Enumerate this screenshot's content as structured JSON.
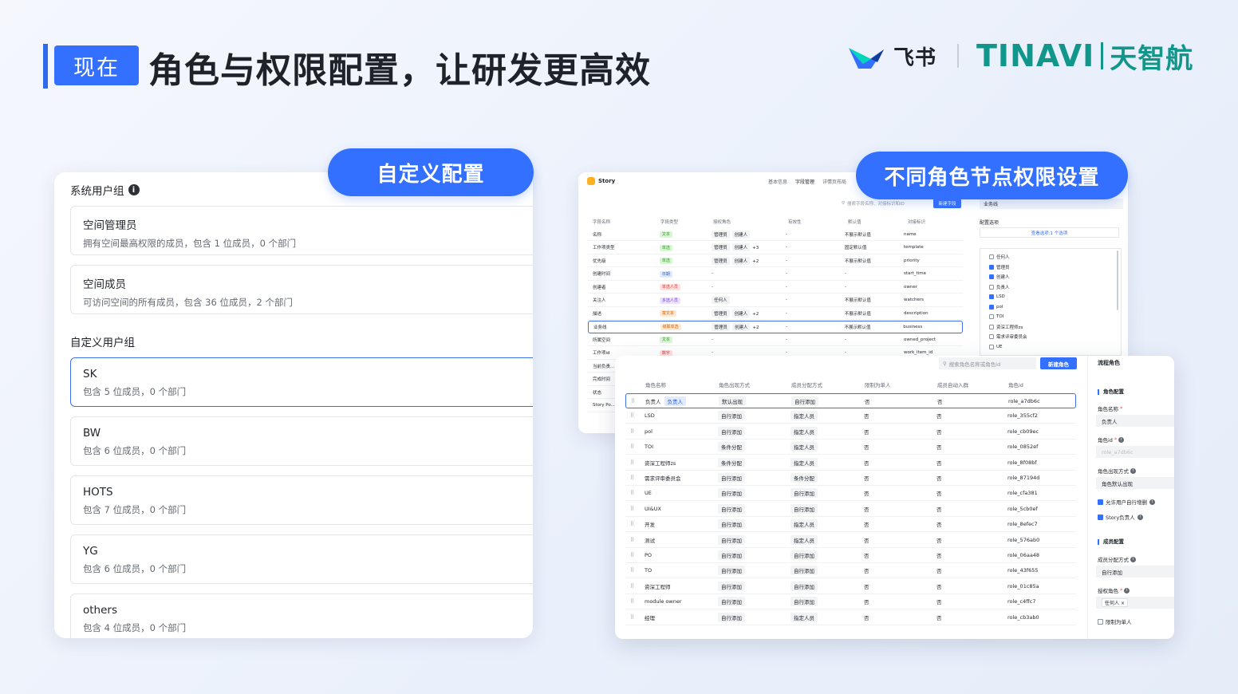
{
  "header": {
    "badge": "现在",
    "title": "角色与权限配置，让研发更高效",
    "brand_feishu": "飞书",
    "brand_tinavi": "TINAVI",
    "brand_tinavi_cn": "天智航",
    "accent_color": "#3370ff",
    "brand_color": "#11968b"
  },
  "pills": {
    "left": "自定义配置",
    "right": "不同角色节点权限设置"
  },
  "left_panel": {
    "system_title": "系统用户组",
    "system_groups": [
      {
        "name": "空间管理员",
        "desc": "拥有空间最高权限的成员，包含 1 位成员，0 个部门"
      },
      {
        "name": "空间成员",
        "desc": "可访问空间的所有成员，包含 36 位成员，2 个部门"
      }
    ],
    "custom_title": "自定义用户组",
    "custom_groups": [
      {
        "name": "SK",
        "desc": "包含 5 位成员，0 个部门"
      },
      {
        "name": "BW",
        "desc": "包含 6 位成员，0 个部门"
      },
      {
        "name": "HOTS",
        "desc": "包含 7 位成员，0 个部门"
      },
      {
        "name": "YG",
        "desc": "包含 6 位成员，0 个部门"
      },
      {
        "name": "others",
        "desc": "包含 4 位成员，0 个部门"
      }
    ]
  },
  "fields_panel": {
    "title": "Story",
    "tabs": [
      "基本信息",
      "字段管理",
      "详情页布局"
    ],
    "search_placeholder": "搜索字段名称、对接标识和ID",
    "new_button": "新建字段",
    "biz_value": "业务线",
    "options_title": "配置选项",
    "options_link": "查看选项:1 个选项",
    "columns": [
      "字段名称",
      "字段类型",
      "授权角色",
      "有效性",
      "默认值",
      "对接标识"
    ],
    "options": [
      {
        "label": "任何人",
        "checked": false
      },
      {
        "label": "管理员",
        "checked": true
      },
      {
        "label": "创建人",
        "checked": true
      },
      {
        "label": "负责人",
        "checked": false
      },
      {
        "label": "LSD",
        "checked": true
      },
      {
        "label": "pol",
        "checked": true
      },
      {
        "label": "TOI",
        "checked": false
      },
      {
        "label": "资深工程师zs",
        "checked": false
      },
      {
        "label": "需求评审委员会",
        "checked": false
      },
      {
        "label": "UE",
        "checked": false
      }
    ],
    "rows": [
      {
        "name": "名称",
        "type": "文本",
        "tag": "green",
        "roles": [
          "管理员",
          "创建人"
        ],
        "extra": "",
        "valid": "-",
        "default": "不展示默认值",
        "key": "name"
      },
      {
        "name": "工作项类型",
        "type": "单选",
        "tag": "green",
        "roles": [
          "管理员",
          "创建人"
        ],
        "extra": "+3",
        "valid": "-",
        "default": "固定默认值",
        "key": "template"
      },
      {
        "name": "优先级",
        "type": "单选",
        "tag": "green",
        "roles": [
          "管理员",
          "创建人"
        ],
        "extra": "+2",
        "valid": "-",
        "default": "不展示默认值",
        "key": "priority"
      },
      {
        "name": "创建时间",
        "type": "日期",
        "tag": "blue",
        "roles": [],
        "extra": "",
        "valid": "-",
        "default": "-",
        "key": "start_time"
      },
      {
        "name": "创建者",
        "type": "单选人员",
        "tag": "red",
        "roles": [],
        "extra": "",
        "valid": "-",
        "default": "-",
        "key": "owner"
      },
      {
        "name": "关注人",
        "type": "多选人员",
        "tag": "purple",
        "roles": [
          "任何人"
        ],
        "extra": "",
        "valid": "-",
        "default": "不展示默认值",
        "key": "watchers"
      },
      {
        "name": "描述",
        "type": "富文本",
        "tag": "orange",
        "roles": [
          "管理员",
          "创建人"
        ],
        "extra": "+2",
        "valid": "-",
        "default": "不展示默认值",
        "key": "description"
      },
      {
        "name": "业务线",
        "type": "级联单选",
        "tag": "orange",
        "roles": [
          "管理员",
          "创建人"
        ],
        "extra": "+2",
        "valid": "-",
        "default": "不展示默认值",
        "key": "business"
      },
      {
        "name": "所属空间",
        "type": "文本",
        "tag": "green",
        "roles": [],
        "extra": "",
        "valid": "-",
        "default": "-",
        "key": "owned_project"
      },
      {
        "name": "工作项id",
        "type": "数字",
        "tag": "red",
        "roles": [],
        "extra": "",
        "valid": "-",
        "default": "-",
        "key": "work_item_id"
      },
      {
        "name": "当前负责...",
        "type": "",
        "tag": "",
        "roles": [],
        "extra": "",
        "valid": "",
        "default": "",
        "key": ""
      },
      {
        "name": "完成时间",
        "type": "",
        "tag": "",
        "roles": [],
        "extra": "",
        "valid": "",
        "default": "",
        "key": ""
      },
      {
        "name": "状态",
        "type": "",
        "tag": "",
        "roles": [],
        "extra": "",
        "valid": "",
        "default": "",
        "key": ""
      },
      {
        "name": "Story Po...",
        "type": "",
        "tag": "",
        "roles": [],
        "extra": "",
        "valid": "",
        "default": "",
        "key": ""
      }
    ]
  },
  "roles_panel": {
    "search_placeholder": "搜索角色名称或角色id",
    "new_button": "新建角色",
    "columns": [
      "角色名称",
      "角色出现方式",
      "成员分配方式",
      "限制为单人",
      "成员自动入群",
      "角色id"
    ],
    "rows": [
      {
        "name": "负责人",
        "owner_tag": "负责人",
        "appear": "默认出现",
        "assign": "自行添加",
        "single": "否",
        "auto": "否",
        "id": "role_a7db6c"
      },
      {
        "name": "LSD",
        "owner_tag": "",
        "appear": "自行添加",
        "assign": "指定人员",
        "single": "否",
        "auto": "否",
        "id": "role_355cf2"
      },
      {
        "name": "pol",
        "owner_tag": "",
        "appear": "自行添加",
        "assign": "指定人员",
        "single": "否",
        "auto": "否",
        "id": "role_cb09ec"
      },
      {
        "name": "TOI",
        "owner_tag": "",
        "appear": "条件分配",
        "assign": "指定人员",
        "single": "否",
        "auto": "否",
        "id": "role_0852ef"
      },
      {
        "name": "资深工程师zs",
        "owner_tag": "",
        "appear": "条件分配",
        "assign": "指定人员",
        "single": "否",
        "auto": "否",
        "id": "role_8f08bf"
      },
      {
        "name": "需求评审委员会",
        "owner_tag": "",
        "appear": "自行添加",
        "assign": "条件分配",
        "single": "否",
        "auto": "否",
        "id": "role_87194d"
      },
      {
        "name": "UE",
        "owner_tag": "",
        "appear": "自行添加",
        "assign": "自行添加",
        "single": "否",
        "auto": "否",
        "id": "role_cfa381"
      },
      {
        "name": "UI&UX",
        "owner_tag": "",
        "appear": "自行添加",
        "assign": "自行添加",
        "single": "否",
        "auto": "否",
        "id": "role_5cb0ef"
      },
      {
        "name": "开发",
        "owner_tag": "",
        "appear": "自行添加",
        "assign": "指定人员",
        "single": "否",
        "auto": "否",
        "id": "role_8efec7"
      },
      {
        "name": "测试",
        "owner_tag": "",
        "appear": "自行添加",
        "assign": "指定人员",
        "single": "否",
        "auto": "否",
        "id": "role_576ab0"
      },
      {
        "name": "PO",
        "owner_tag": "",
        "appear": "自行添加",
        "assign": "自行添加",
        "single": "否",
        "auto": "否",
        "id": "role_06aa48"
      },
      {
        "name": "TO",
        "owner_tag": "",
        "appear": "自行添加",
        "assign": "自行添加",
        "single": "否",
        "auto": "否",
        "id": "role_43f655"
      },
      {
        "name": "资深工程师",
        "owner_tag": "",
        "appear": "自行添加",
        "assign": "自行添加",
        "single": "否",
        "auto": "否",
        "id": "role_01c85a"
      },
      {
        "name": "module owner",
        "owner_tag": "",
        "appear": "自行添加",
        "assign": "自行添加",
        "single": "否",
        "auto": "否",
        "id": "role_c4ffc7"
      },
      {
        "name": "经理",
        "owner_tag": "",
        "appear": "自行添加",
        "assign": "指定人员",
        "single": "否",
        "auto": "否",
        "id": "role_cb3ab0"
      }
    ],
    "side": {
      "title": "流程角色",
      "section_role": "角色配置",
      "label_name": "角色名称",
      "value_name": "负责人",
      "label_id": "角色id",
      "value_id": "role_a7db6c",
      "label_appear": "角色出现方式",
      "value_appear": "角色默认出现",
      "check_allow_delete": "允许用户自行增删",
      "check_story_owner": "Story负责人",
      "section_member": "成员配置",
      "label_assign": "成员分配方式",
      "value_assign": "自行添加",
      "label_auth_role": "授权角色",
      "value_auth_role": "任何人",
      "check_single": "限制为单人"
    }
  }
}
